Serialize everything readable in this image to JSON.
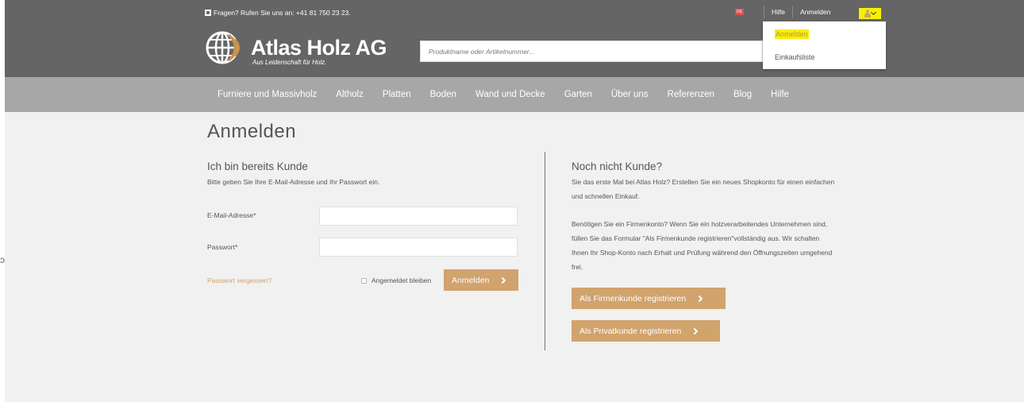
{
  "topbar": {
    "contact": "Fragen? Rufen Sie uns an: +41 81 750 23 23.",
    "lang": "DE",
    "help": "Hilfe",
    "login": "Anmelden"
  },
  "logo": {
    "title": "Atlas Holz AG",
    "tagline": "Aus Leidenschaft für Holz."
  },
  "search": {
    "placeholder": "Produktname oder Artikelnummer..."
  },
  "account_dropdown": {
    "items": [
      "Anmelden",
      "Einkaufsliste"
    ],
    "highlight_color": "#f4f200"
  },
  "nav": {
    "items": [
      "Furniere und Massivholz",
      "Altholz",
      "Platten",
      "Boden",
      "Wand und Decke",
      "Garten",
      "Über uns",
      "Referenzen",
      "Blog",
      "Hilfe"
    ]
  },
  "page": {
    "title": "Anmelden"
  },
  "login": {
    "heading": "Ich bin bereits Kunde",
    "intro": "Bitte geben Sie Ihre E-Mail-Adresse und Ihr Passwort ein.",
    "email_label": "E-Mail-Adresse*",
    "password_label": "Passwort*",
    "forgot": "Passwort vergessen?",
    "remember": "Angemeldet bleiben",
    "submit": "Anmelden"
  },
  "register": {
    "heading": "Noch nicht Kunde?",
    "intro_line1": "Sie das erste Mal bei Atlas Holz? Erstellen Sie ein neues Shopkonto für einen einfachen",
    "intro_line2": "und schnellen Einkauf.",
    "business_line1": "Benötigen Sie ein Firmenkonto? Wenn Sie ein holzverarbeitendes Unternehmen sind,",
    "business_line2": "füllen Sie das Formular \"Als Firmenkunde registrieren\"vollständig aus. Wir schalten",
    "business_line3": "Ihnen Ihr Shop-Konto nach Erhalt und Prüfung während den Öffnungszeiten umgehend",
    "business_line4": "frei.",
    "btn_business": "Als Firmenkunde registrieren",
    "btn_private": "Als Privatkunde registrieren"
  },
  "colors": {
    "header": "#656565",
    "nav": "#a7a7a7",
    "accent": "#d1a36d",
    "content_bg": "#f1f1f1"
  }
}
